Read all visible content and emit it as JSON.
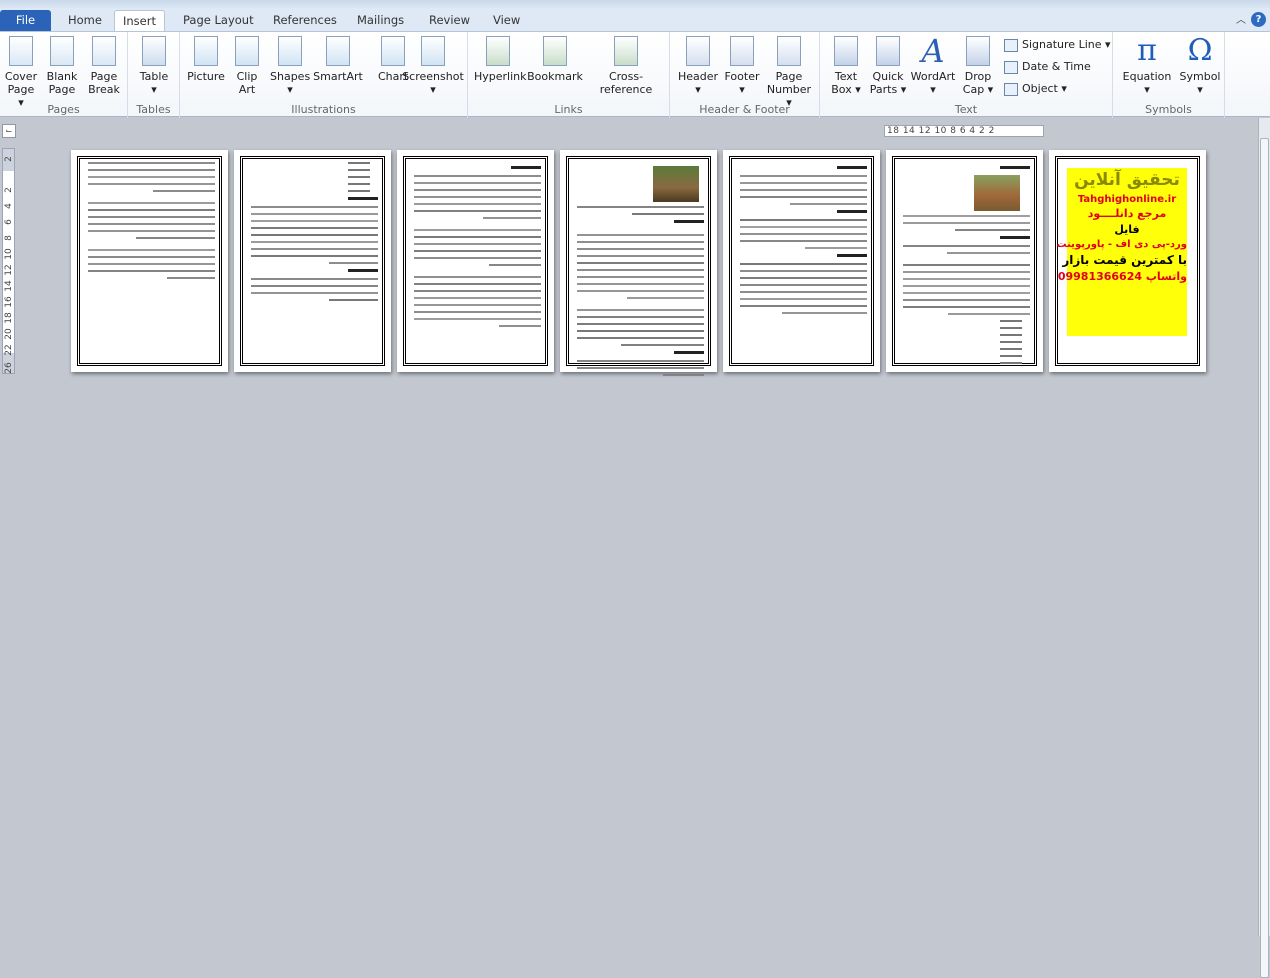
{
  "tabs": [
    {
      "label": "File"
    },
    {
      "label": "Home"
    },
    {
      "label": "Insert"
    },
    {
      "label": "Page Layout"
    },
    {
      "label": "References"
    },
    {
      "label": "Mailings"
    },
    {
      "label": "Review"
    },
    {
      "label": "View"
    }
  ],
  "active_tab": "Insert",
  "help_label": "?",
  "groups": {
    "pages": {
      "label": "Pages",
      "buttons": [
        {
          "l1": "Cover",
          "l2": "Page ▾"
        },
        {
          "l1": "Blank",
          "l2": "Page"
        },
        {
          "l1": "Page",
          "l2": "Break"
        }
      ]
    },
    "tables": {
      "label": "Tables",
      "buttons": [
        {
          "l1": "Table",
          "l2": "▾"
        }
      ]
    },
    "illustrations": {
      "label": "Illustrations",
      "buttons": [
        {
          "l1": "Picture",
          "l2": ""
        },
        {
          "l1": "Clip",
          "l2": "Art"
        },
        {
          "l1": "Shapes",
          "l2": "▾"
        },
        {
          "l1": "SmartArt",
          "l2": ""
        },
        {
          "l1": "Chart",
          "l2": ""
        },
        {
          "l1": "Screenshot",
          "l2": "▾"
        }
      ]
    },
    "links": {
      "label": "Links",
      "buttons": [
        {
          "l1": "Hyperlink",
          "l2": ""
        },
        {
          "l1": "Bookmark",
          "l2": ""
        },
        {
          "l1": "Cross-reference",
          "l2": ""
        }
      ]
    },
    "header_footer": {
      "label": "Header & Footer",
      "buttons": [
        {
          "l1": "Header",
          "l2": "▾"
        },
        {
          "l1": "Footer",
          "l2": "▾"
        },
        {
          "l1": "Page",
          "l2": "Number ▾"
        }
      ]
    },
    "text": {
      "label": "Text",
      "buttons": [
        {
          "l1": "Text",
          "l2": "Box ▾"
        },
        {
          "l1": "Quick",
          "l2": "Parts ▾"
        },
        {
          "l1": "WordArt",
          "l2": "▾"
        },
        {
          "l1": "Drop",
          "l2": "Cap ▾"
        }
      ],
      "small": [
        {
          "label": "Signature Line ▾"
        },
        {
          "label": "Date & Time"
        },
        {
          "label": "Object ▾"
        }
      ]
    },
    "symbols": {
      "label": "Symbols",
      "buttons": [
        {
          "l1": "Equation",
          "l2": "▾"
        },
        {
          "l1": "Symbol",
          "l2": "▾"
        }
      ]
    }
  },
  "ruler": {
    "horizontal": "18  14 12 10 8 6 4 2   2",
    "vertical": [
      "2",
      "2",
      "4",
      "6",
      "8",
      "10",
      "12",
      "14",
      "16",
      "18",
      "20",
      "22",
      "26"
    ]
  },
  "ad": {
    "title": "تحقیق آنلاین",
    "site": "Tahghighonline.ir",
    "line1": "مرجع دانلــــود",
    "line2": "فایل",
    "line3": "ورد-پی دی اف - پاورپوینت",
    "line4": "با کمترین قیمت بازار",
    "phone": "09981366624",
    "whatsapp": "واتساپ"
  },
  "colors": {
    "accent": "#2a63b8",
    "ad_bg": "#ffff0a",
    "ad_red": "#e3001b"
  }
}
